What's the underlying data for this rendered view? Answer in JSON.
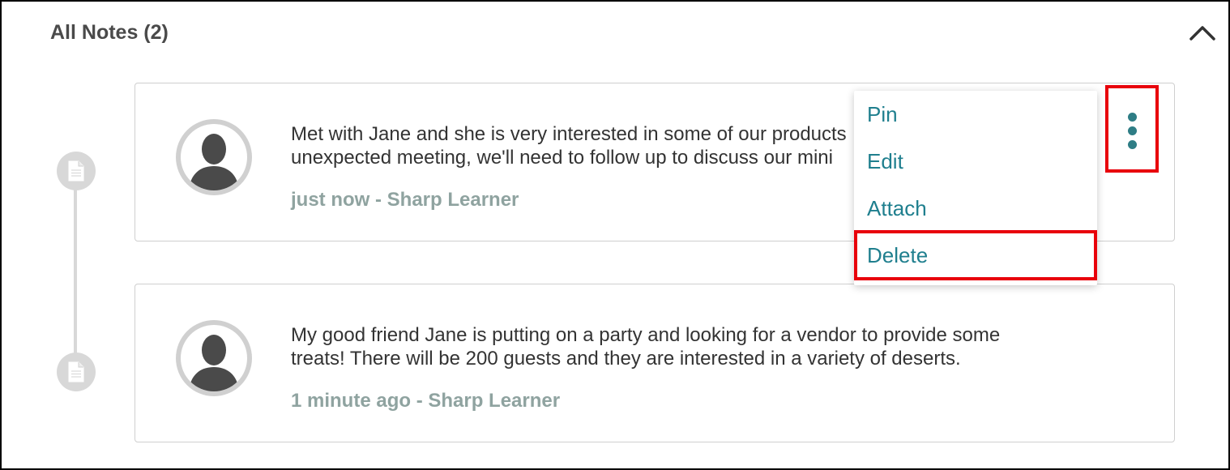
{
  "section": {
    "title": "All Notes (2)",
    "collapse_icon": "chevron-up-icon"
  },
  "notes": [
    {
      "text_lines": [
        "Met with Jane and she is very interested in some of our products",
        "unexpected meeting, we'll need to follow up to discuss our mini"
      ],
      "meta": "just now - Sharp Learner",
      "icon": "document-icon"
    },
    {
      "text_lines": [
        "My good friend Jane is putting on a party and looking for a vendor to provide some",
        "treats! There will be 200 guests and they are interested in a variety of deserts."
      ],
      "meta": "1 minute ago - Sharp Learner",
      "icon": "document-icon"
    }
  ],
  "menu": {
    "trigger_icon": "more-vertical-icon",
    "items": [
      {
        "label": "Pin"
      },
      {
        "label": "Edit"
      },
      {
        "label": "Attach"
      },
      {
        "label": "Delete"
      }
    ]
  },
  "colors": {
    "accent": "#1f7f8e",
    "highlight": "#e8000b",
    "meta": "#8fa3a0",
    "border": "#cfcfcf"
  }
}
